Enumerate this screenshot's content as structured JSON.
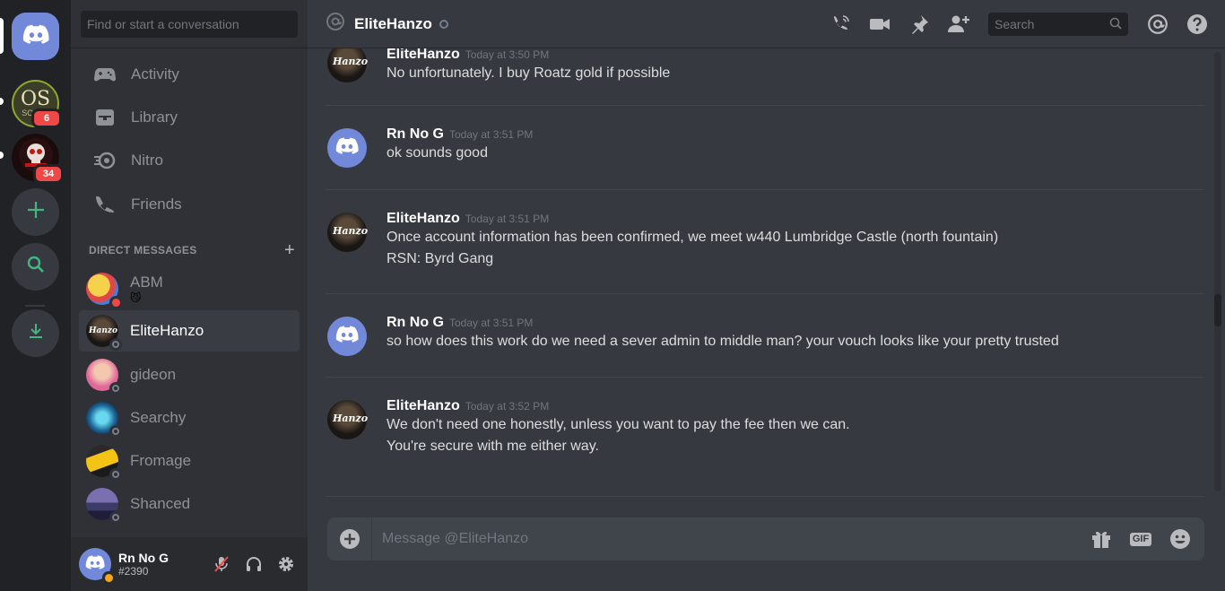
{
  "servers": [
    {
      "name": "OS Scape",
      "label_line1": "OS",
      "label_line2": "SCAPE",
      "badge": "6"
    },
    {
      "name": "server-2",
      "badge": "34"
    }
  ],
  "sidebar": {
    "search_placeholder": "Find or start a conversation",
    "nav": [
      {
        "label": "Activity"
      },
      {
        "label": "Library"
      },
      {
        "label": "Nitro"
      },
      {
        "label": "Friends"
      }
    ],
    "dm_header": "DIRECT MESSAGES",
    "dm_plus": "+",
    "dms": [
      {
        "name": "ABM",
        "sub": "😼"
      },
      {
        "name": "EliteHanzo"
      },
      {
        "name": "gideon"
      },
      {
        "name": "Searchy"
      },
      {
        "name": "Fromage"
      },
      {
        "name": "Shanced"
      }
    ]
  },
  "user": {
    "name": "Rn No G",
    "tag": "#2390"
  },
  "topbar": {
    "at": "@",
    "channel": "EliteHanzo",
    "search_placeholder": "Search"
  },
  "messages": [
    {
      "author": "EliteHanzo",
      "time": "Today at 3:50 PM",
      "lines": [
        "No unfortunately. I buy Roatz gold if possible"
      ]
    },
    {
      "author": "Rn No G",
      "time": "Today at 3:51 PM",
      "lines": [
        "ok sounds good"
      ]
    },
    {
      "author": "EliteHanzo",
      "time": "Today at 3:51 PM",
      "lines": [
        "Once account information has been confirmed, we meet w440 Lumbridge Castle (north fountain)",
        "RSN: Byrd Gang"
      ]
    },
    {
      "author": "Rn No G",
      "time": "Today at 3:51 PM",
      "lines": [
        "so how does this work do we need a sever admin to middle man? your vouch looks like your pretty trusted"
      ]
    },
    {
      "author": "EliteHanzo",
      "time": "Today at 3:52 PM",
      "lines": [
        "We don't need one honestly, unless you want to pay the fee then we can.",
        "You're secure with me either way."
      ]
    }
  ],
  "avatar_text": "Hanzo",
  "composer": {
    "placeholder": "Message @EliteHanzo",
    "gif_label": "GIF"
  },
  "colors": {
    "blurple": "#7289da",
    "green": "#43b581",
    "red": "#f04747",
    "bg": "#36393f"
  }
}
